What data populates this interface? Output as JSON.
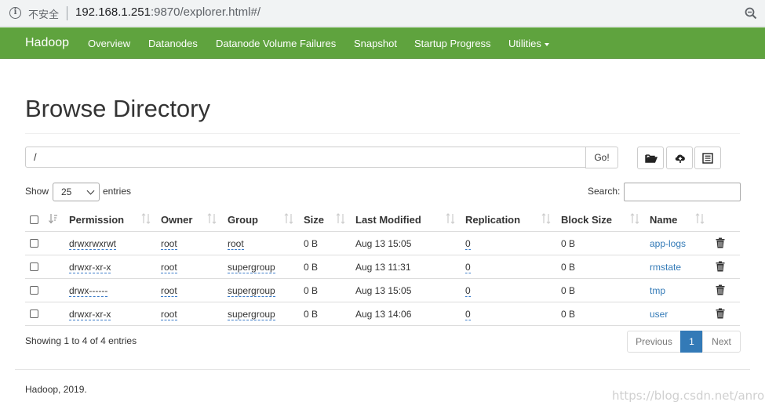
{
  "browser": {
    "security_label": "不安全",
    "url_host": "192.168.1.251",
    "url_rest": ":9870/explorer.html#/"
  },
  "navbar": {
    "brand": "Hadoop",
    "items": [
      "Overview",
      "Datanodes",
      "Datanode Volume Failures",
      "Snapshot",
      "Startup Progress",
      "Utilities"
    ]
  },
  "page": {
    "title": "Browse Directory",
    "path_value": "/",
    "go_label": "Go!"
  },
  "controls": {
    "show_label": "Show",
    "entries_value": "25",
    "entries_label": "entries",
    "search_label": "Search:"
  },
  "table": {
    "columns": [
      "Permission",
      "Owner",
      "Group",
      "Size",
      "Last Modified",
      "Replication",
      "Block Size",
      "Name"
    ],
    "rows": [
      {
        "permission": "drwxrwxrwt",
        "owner": "root",
        "group": "root",
        "size": "0 B",
        "modified": "Aug 13 15:05",
        "replication": "0",
        "block_size": "0 B",
        "name": "app-logs"
      },
      {
        "permission": "drwxr-xr-x",
        "owner": "root",
        "group": "supergroup",
        "size": "0 B",
        "modified": "Aug 13 11:31",
        "replication": "0",
        "block_size": "0 B",
        "name": "rmstate"
      },
      {
        "permission": "drwx------",
        "owner": "root",
        "group": "supergroup",
        "size": "0 B",
        "modified": "Aug 13 15:05",
        "replication": "0",
        "block_size": "0 B",
        "name": "tmp"
      },
      {
        "permission": "drwxr-xr-x",
        "owner": "root",
        "group": "supergroup",
        "size": "0 B",
        "modified": "Aug 13 14:06",
        "replication": "0",
        "block_size": "0 B",
        "name": "user"
      }
    ]
  },
  "pagination": {
    "info": "Showing 1 to 4 of 4 entries",
    "previous": "Previous",
    "current": "1",
    "next": "Next"
  },
  "footer": {
    "text": "Hadoop, 2019.",
    "watermark": "https://blog.csdn.net/anron"
  },
  "colors": {
    "navbar": "#5fa33e",
    "link": "#337ab7",
    "active_page": "#337ab7"
  },
  "icons": [
    "info-icon",
    "zoom-icon",
    "folder-open-icon",
    "upload-icon",
    "list-icon",
    "sort-icon",
    "trash-icon"
  ]
}
